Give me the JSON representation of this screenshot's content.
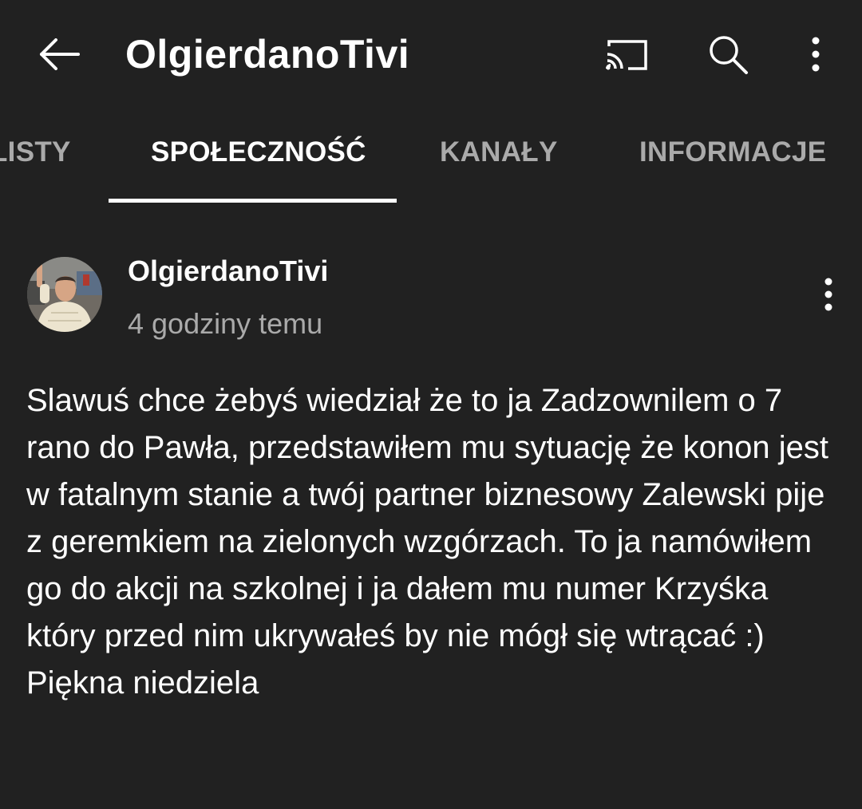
{
  "appbar": {
    "title": "OlgierdanoTivi",
    "back_icon": "arrow-left-icon",
    "cast_icon": "cast-icon",
    "search_icon": "search-icon",
    "more_icon": "more-vertical-icon"
  },
  "tabs": [
    {
      "label": "LISTY",
      "active": false
    },
    {
      "label": "SPOŁECZNOŚĆ",
      "active": true
    },
    {
      "label": "KANAŁY",
      "active": false
    },
    {
      "label": "INFORMACJE",
      "active": false
    }
  ],
  "post": {
    "author": "OlgierdanoTivi",
    "time": "4 godziny temu",
    "body": "Slawuś chce żebyś wiedział że to ja Zadzownilem o 7 rano do Pawła, przedstawiłem mu sytuację że konon jest w fatalnym stanie a twój partner biznesowy Zalewski pije z geremkiem na zielonych wzgórzach. To ja namówiłem go do akcji na szkolnej i ja dałem mu numer Krzyśka który przed nim ukrywałeś by nie mógł się wtrącać :)\nPiękna niedziela",
    "menu_icon": "more-vertical-icon"
  },
  "colors": {
    "background": "#212121",
    "text_primary": "#ffffff",
    "text_secondary": "#aaaaaa",
    "tab_indicator": "#ffffff"
  }
}
